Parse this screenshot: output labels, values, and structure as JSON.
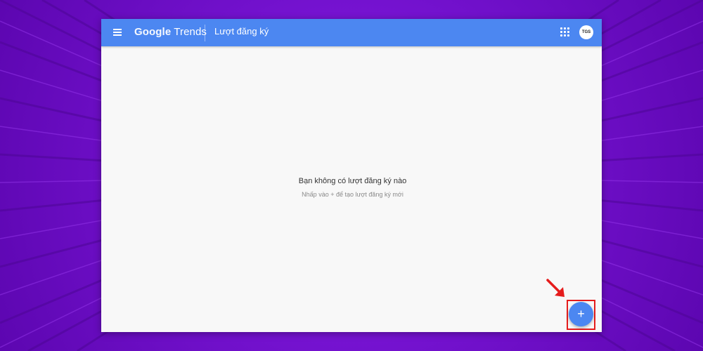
{
  "app": {
    "brand_google": "Google",
    "brand_trends": "Trends",
    "page_title": "Lượt đăng ký",
    "avatar_initials": "TGS",
    "accent_color": "#4c87f1"
  },
  "icons": {
    "menu": "menu-icon",
    "apps": "apps-grid-icon",
    "add": "plus-icon",
    "annotation": "red-arrow-icon"
  },
  "empty_state": {
    "title": "Bạn không có lượt đăng ký nào",
    "hint": "Nhấp vào + để tạo lượt đăng ký mới"
  },
  "fab": {
    "label": "+"
  },
  "annotation": {
    "color": "#e51c1c"
  }
}
